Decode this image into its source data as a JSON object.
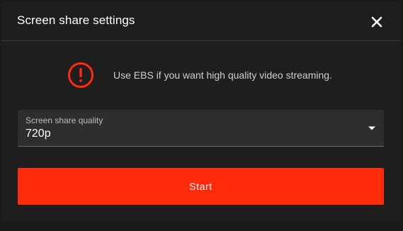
{
  "dialog": {
    "title": "Screen share settings",
    "close_icon": "close-icon"
  },
  "notice": {
    "icon": "warning-circle-icon",
    "icon_color": "#ff2b0a",
    "text": "Use EBS if you want high quality video streaming."
  },
  "quality_select": {
    "label": "Screen share quality",
    "value": "720p",
    "icon": "dropdown-arrow-icon"
  },
  "start_button": {
    "label": "Start",
    "color": "#ff2b0a"
  }
}
